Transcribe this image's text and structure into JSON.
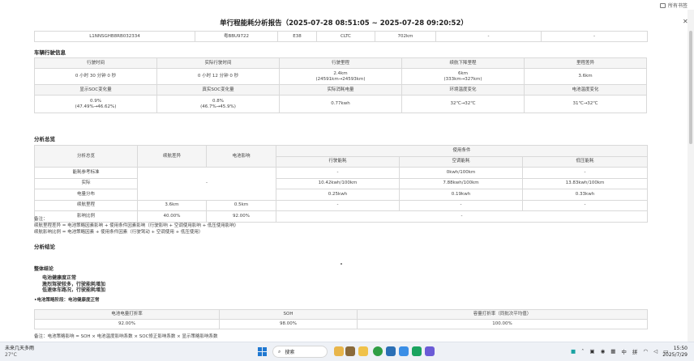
{
  "browser": {
    "favorites": "所有书签"
  },
  "report": {
    "title": "单行程能耗分析报告（2025-07-28 08:51:05 ~ 2025-07-28 09:20:52）"
  },
  "vehicle_row": [
    "L1NNSGHB8RB032334",
    "粤BBU9722",
    "E38",
    "CLTC",
    "702km",
    "-",
    "-"
  ],
  "vehicle_info": {
    "section": "车辆行驶信息",
    "row1_headers": [
      "行驶时间",
      "实际行驶时间",
      "行驶里程",
      "续航下降里程",
      "里程差异"
    ],
    "row1_values": [
      [
        "0 小时 30 分钟 0 秒"
      ],
      [
        "0 小时 12 分钟 0 秒"
      ],
      [
        "2.4km",
        "(24591km→24593km)"
      ],
      [
        "6km",
        "(333km→327km)"
      ],
      [
        "3.6km"
      ]
    ],
    "row2_headers": [
      "显示SOC变化量",
      "真实SOC变化量",
      "实际消耗电量",
      "环境温度变化",
      "电池温度变化"
    ],
    "row2_values": [
      [
        "0.9%",
        "(47.49%→46.62%)"
      ],
      [
        "0.8%",
        "(46.7%→45.9%)"
      ],
      [
        "0.77kwh"
      ],
      [
        "32℃→32℃"
      ],
      [
        "31℃→32℃"
      ]
    ]
  },
  "analysis": {
    "section": "分析总览",
    "headers": {
      "overview": "分析总览",
      "range_diff": "续航差异",
      "battery_impact": "电池影响",
      "usage": "使用条件",
      "driving": "行驶能耗",
      "ac": "空调能耗",
      "lv": "低压能耗"
    },
    "rows": [
      {
        "label": "能耗参考标准",
        "driving": "-",
        "ac": "0kwh/100km",
        "lv": "-"
      },
      {
        "label": "实际",
        "range_diff": "-",
        "driving": "10.42kwh/100km",
        "ac": "7.88kwh/100km",
        "lv": "13.83kwh/100km"
      },
      {
        "label": "电量分布",
        "driving": "0.25kwh",
        "ac": "0.19kwh",
        "lv": "0.33kwh"
      },
      {
        "label": "续航里程",
        "range_diff": "3.6km",
        "battery": "0.5km",
        "driving": "-",
        "ac": "-",
        "lv": "-"
      },
      {
        "label": "影响比例",
        "range_diff": "40.00%",
        "battery": "92.00%",
        "usage": "-"
      }
    ]
  },
  "notes": {
    "title": "备注：",
    "line1": "续航里程差异 = 电池策略因素影响 + 使用条件因素影响（行驶影响 + 空调使用影响 + 低压使用影响）",
    "line2": "续航影响比例 = 电池策略因素 + 使用条件因素（行驶驾动 + 空调使用 + 低压使用）"
  },
  "conclusion": {
    "section": "分析结论",
    "overall": "整体结论",
    "items": [
      "电池健康度正常",
      "激烈驾驶较多，行驶能耗增加",
      "低速体车路况，行驶能耗增加"
    ],
    "battery_stage": "•电池策略阶段：电池健康度正常"
  },
  "battery_table": {
    "headers": [
      "电池电量打折率",
      "SOH",
      "容量打折率（同批次平均值）"
    ],
    "values": [
      "92.00%",
      "98.00%",
      "100.00%"
    ]
  },
  "footer_note": "备注：电池策略影响 = SOH × 电池温度影响系数 × SOC修正影响系数 × 显示策略影响系数",
  "taskbar": {
    "weather_title": "未来几天多雨",
    "weather_temp": "27°C",
    "search": "搜索",
    "lang": "中",
    "ime": "拼",
    "time": "15:50",
    "date": "2025/7/29"
  }
}
